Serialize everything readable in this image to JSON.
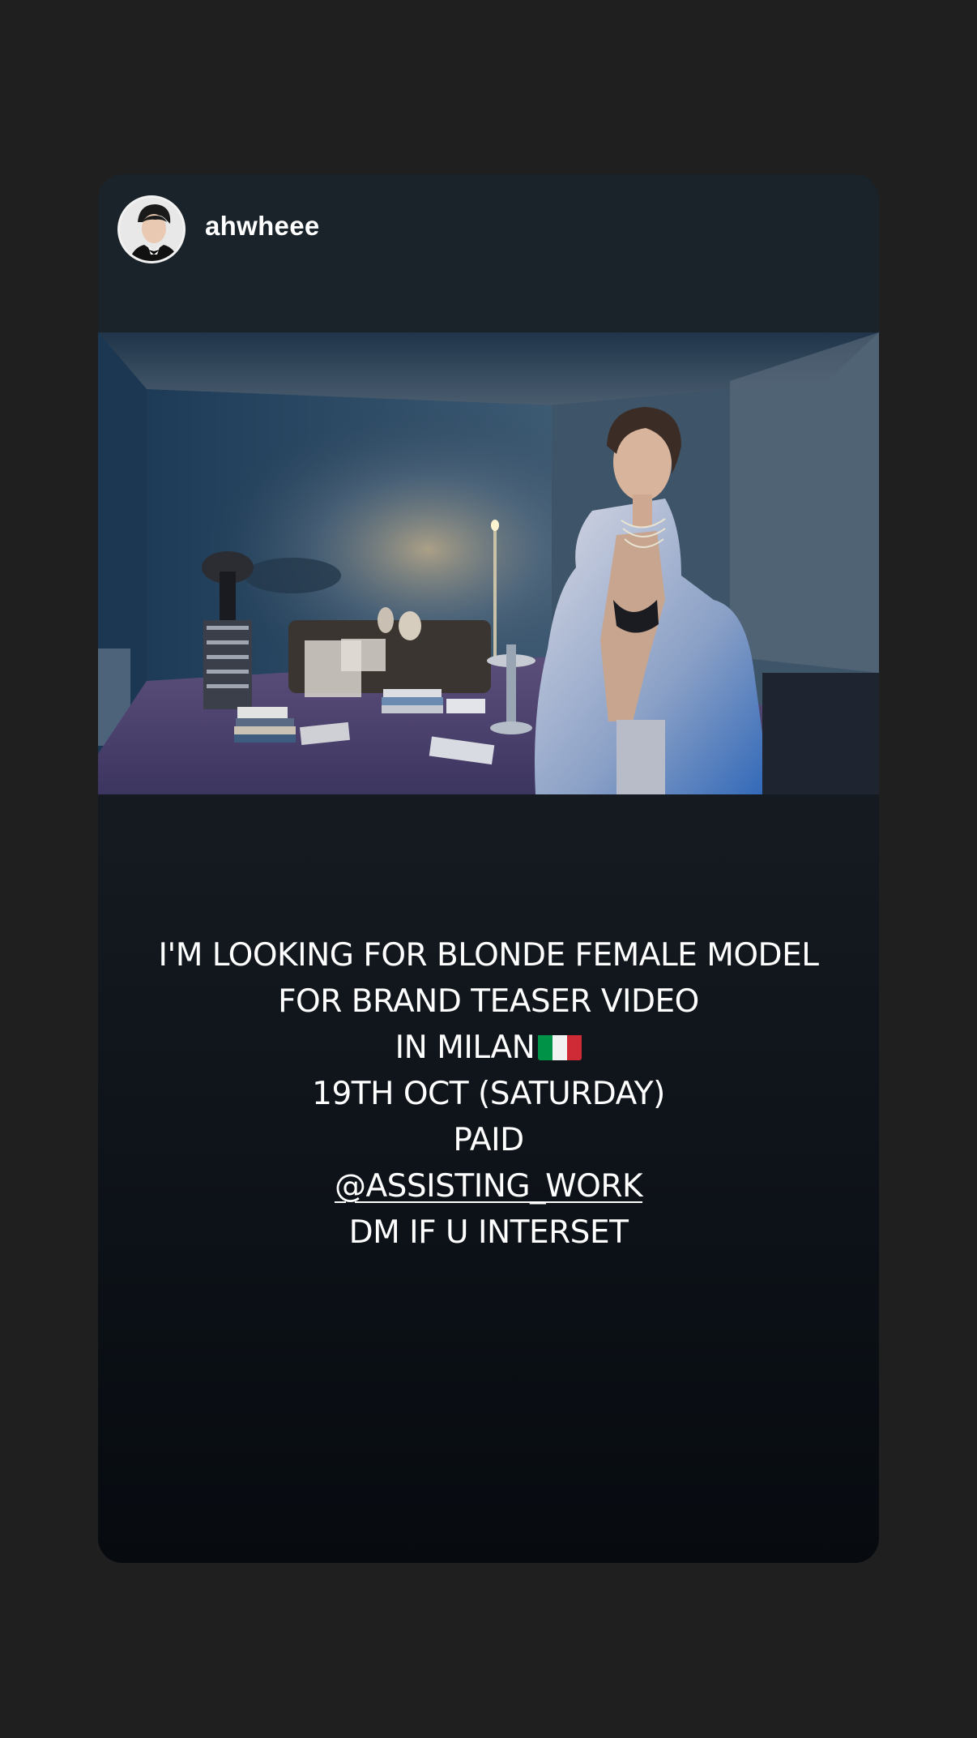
{
  "story": {
    "username": "ahwheee",
    "message": {
      "line1": "I'M LOOKING FOR BLONDE FEMALE MODEL",
      "line2": "FOR BRAND TEASER VIDEO",
      "line3": "IN MILAN",
      "line3_emoji": "italy-flag-icon",
      "line4": "19TH OCT (SATURDAY)",
      "line5": "PAID",
      "mention": "@ASSISTING_WORK",
      "line7": "DM IF U INTERSET"
    }
  },
  "colors": {
    "page_background": "#1f1f1f",
    "card_background": "#161c22",
    "text": "#ffffff",
    "flag_green": "#009246",
    "flag_white": "#f1f2f1",
    "flag_red": "#ce2b37"
  }
}
